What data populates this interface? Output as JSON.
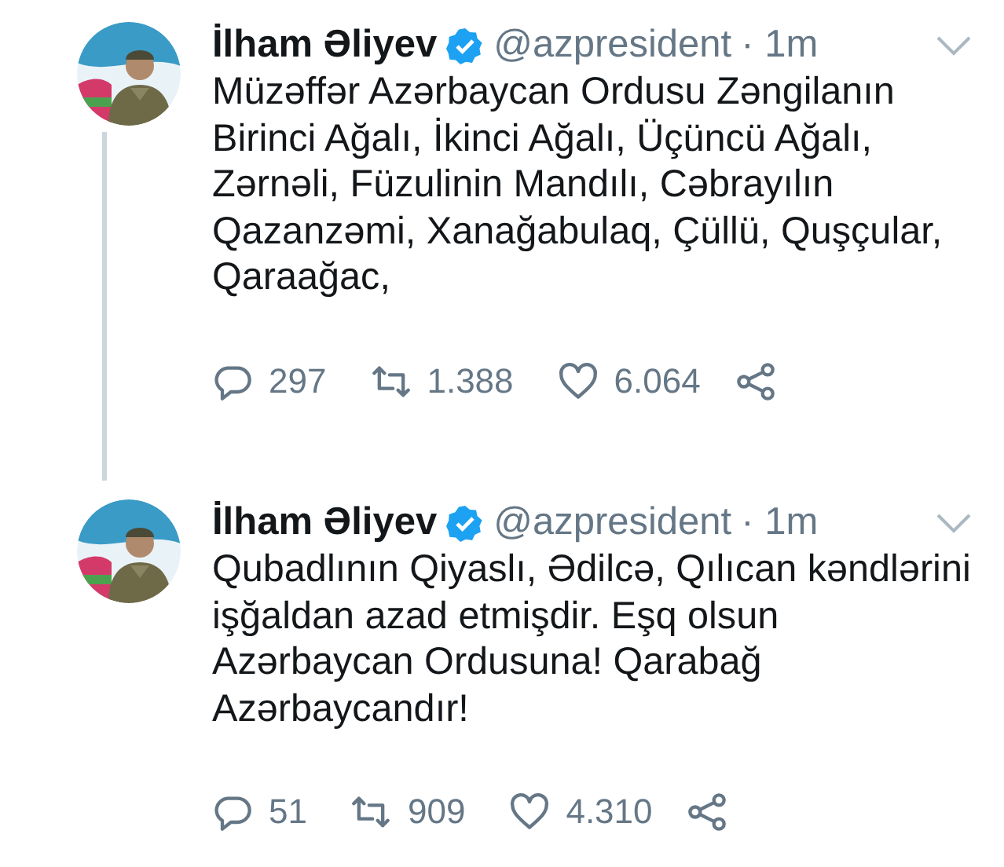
{
  "tweets": [
    {
      "name": "İlham Əliyev",
      "verified": true,
      "handle": "@azpresident",
      "time": "· 1m",
      "thread_line": true,
      "text": "Müzəffər Azərbaycan Ordusu Zəngilanın Birinci Ağalı, İkinci Ağalı, Üçüncü Ağalı, Zərnəli, Füzulinin Mandılı, Cəbrayılın Qazanzəmi, Xanağabulaq, Çüllü, Quşçular, Qaraağac,",
      "replies": "297",
      "retweets": "1.388",
      "likes": "6.064"
    },
    {
      "name": "İlham Əliyev",
      "verified": true,
      "handle": "@azpresident",
      "time": "· 1m",
      "thread_line": false,
      "text": "Qubadlının Qiyaslı, Ədilcə, Qılıcan kəndlərini işğaldan azad etmişdir. Eşq olsun Azərbaycan Ordusuna! Qarabağ Azərbaycandır!",
      "replies": "51",
      "retweets": "909",
      "likes": "4.310"
    }
  ]
}
